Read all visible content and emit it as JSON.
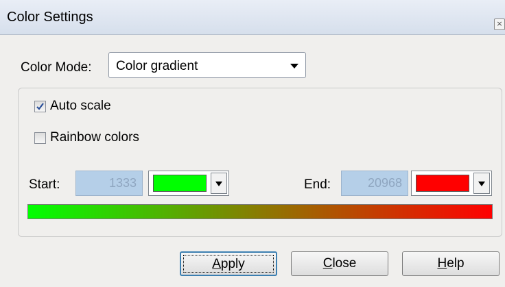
{
  "window": {
    "title": "Color Settings",
    "close_glyph": "×"
  },
  "color_mode": {
    "label": "Color Mode:",
    "selected": "Color gradient"
  },
  "options": {
    "auto_scale": {
      "label": "Auto scale",
      "checked": true
    },
    "rainbow_colors": {
      "label": "Rainbow colors",
      "checked": false
    }
  },
  "range": {
    "start_label": "Start:",
    "start_value": "1333",
    "start_color": "#00ff00",
    "end_label": "End:",
    "end_value": "20968",
    "end_color": "#ff0000"
  },
  "gradient": {
    "from": "#00ff00",
    "to": "#ff0000"
  },
  "buttons": {
    "apply": {
      "mnemonic": "A",
      "rest": "pply"
    },
    "close": {
      "mnemonic": "C",
      "rest": "lose"
    },
    "help": {
      "mnemonic": "H",
      "rest": "elp"
    }
  }
}
